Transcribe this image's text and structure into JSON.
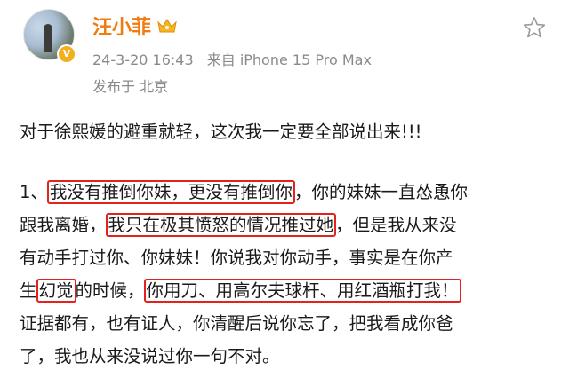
{
  "post": {
    "username": "汪小菲",
    "date": "24-3-20 16:43",
    "source": "来自 iPhone 15 Pro Max",
    "location": "发布于 北京"
  },
  "content": {
    "headline": "对于徐熙媛的避重就轻，这次我一定要全部说出来!!!",
    "l1_a": "1、",
    "l1_b": "我没有推倒你妹，更没有推倒你",
    "l1_c": "，你的妹妹一直怂恿你",
    "l2_a": "跟我离婚，",
    "l2_b": "我只在极其愤怒的情况推过她",
    "l2_c": "，但是我从来没",
    "l3": "有动手打过你、你妹妹！你说我对你动手，事实是在你产",
    "l4_a": "生",
    "l4_b": "幻觉",
    "l4_c": "的时候，",
    "l4_d": "你用刀、用高尔夫球杆、用红酒瓶打我！",
    "l5": "证据都有，也有证人，你清醒后说你忘了，把我看成你爸",
    "l6": "了，我也从来没说过你一句不对。"
  },
  "icons": {
    "avatar": "profile-photo",
    "verified": "verified-badge-icon",
    "vip": "crown-icon",
    "favorite": "star-icon"
  },
  "colors": {
    "username": "#f27a0e",
    "highlight_box": "#e2221e",
    "meta": "#8a8a8a"
  }
}
